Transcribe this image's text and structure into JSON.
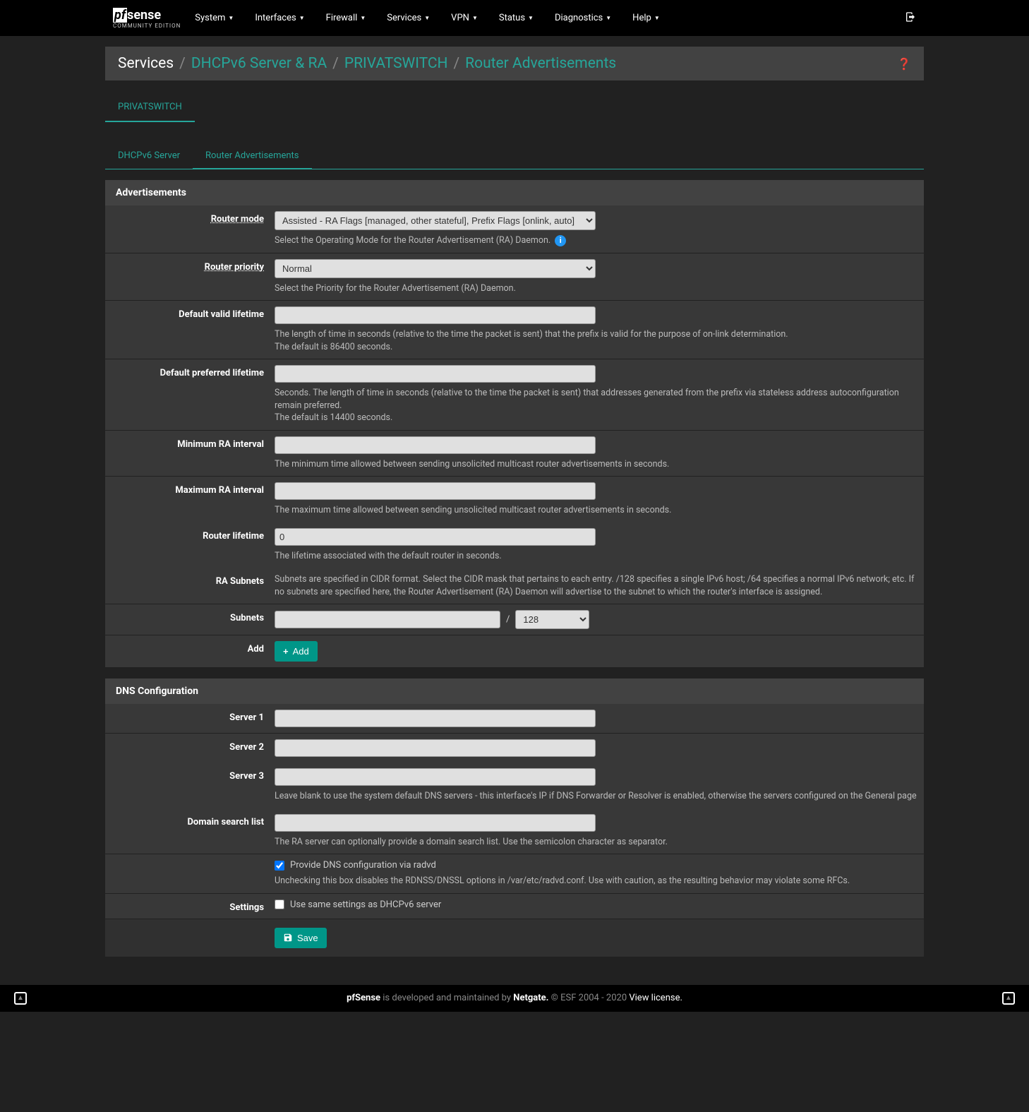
{
  "nav": {
    "logo_main_pf": "pf",
    "logo_main_sense": "sense",
    "logo_sub": "COMMUNITY EDITION",
    "items": [
      "System",
      "Interfaces",
      "Firewall",
      "Services",
      "VPN",
      "Status",
      "Diagnostics",
      "Help"
    ]
  },
  "breadcrumb": {
    "root": "Services",
    "link1": "DHCPv6 Server & RA",
    "link2": "PRIVATSWITCH",
    "current": "Router Advertisements"
  },
  "outer_tab": "PRIVATSWITCH",
  "inner_tabs": {
    "t0": "DHCPv6 Server",
    "t1": "Router Advertisements"
  },
  "adv": {
    "title": "Advertisements",
    "router_mode": {
      "label": "Router mode",
      "value": "Assisted - RA Flags [managed, other stateful], Prefix Flags [onlink, auto]",
      "help": "Select the Operating Mode for the Router Advertisement (RA) Daemon."
    },
    "router_priority": {
      "label": "Router priority",
      "value": "Normal",
      "help": "Select the Priority for the Router Advertisement (RA) Daemon."
    },
    "default_valid": {
      "label": "Default valid lifetime",
      "value": "",
      "help1": "The length of time in seconds (relative to the time the packet is sent) that the prefix is valid for the purpose of on-link determination.",
      "help2": "The default is 86400 seconds."
    },
    "default_pref": {
      "label": "Default preferred lifetime",
      "value": "",
      "help1": "Seconds. The length of time in seconds (relative to the time the packet is sent) that addresses generated from the prefix via stateless address autoconfiguration remain preferred.",
      "help2": "The default is 14400 seconds."
    },
    "min_ra": {
      "label": "Minimum RA interval",
      "value": "",
      "help": "The minimum time allowed between sending unsolicited multicast router advertisements in seconds."
    },
    "max_ra": {
      "label": "Maximum RA interval",
      "value": "",
      "help": "The maximum time allowed between sending unsolicited multicast router advertisements in seconds."
    },
    "router_life": {
      "label": "Router lifetime",
      "value": "0",
      "help": "The lifetime associated with the default router in seconds."
    },
    "ra_subnets": {
      "label": "RA Subnets",
      "help": "Subnets are specified in CIDR format. Select the CIDR mask that pertains to each entry. /128 specifies a single IPv6 host; /64 specifies a normal IPv6 network; etc. If no subnets are specified here, the Router Advertisement (RA) Daemon will advertise to the subnet to which the router's interface is assigned."
    },
    "subnets": {
      "label": "Subnets",
      "value": "",
      "sep": "/",
      "mask": "128"
    },
    "add": {
      "label": "Add",
      "btn": "Add"
    }
  },
  "dns": {
    "title": "DNS Configuration",
    "s1": {
      "label": "Server 1",
      "value": ""
    },
    "s2": {
      "label": "Server 2",
      "value": ""
    },
    "s3": {
      "label": "Server 3",
      "value": "",
      "help": "Leave blank to use the system default DNS servers - this interface's IP if DNS Forwarder or Resolver is enabled, otherwise the servers configured on the General page"
    },
    "search": {
      "label": "Domain search list",
      "value": "",
      "help": "The RA server can optionally provide a domain search list. Use the semicolon character as separator."
    },
    "radvd": {
      "cb_label": "Provide DNS configuration via radvd",
      "help": "Unchecking this box disables the RDNSS/DNSSL options in /var/etc/radvd.conf. Use with caution, as the resulting behavior may violate some RFCs."
    },
    "settings": {
      "label": "Settings",
      "cb_label": "Use same settings as DHCPv6 server"
    }
  },
  "save_btn": "Save",
  "footer": {
    "t1": "pfSense",
    "t2": " is developed and maintained by ",
    "t3": "Netgate.",
    "t4": " © ESF 2004 - 2020 ",
    "t5": "View license."
  }
}
